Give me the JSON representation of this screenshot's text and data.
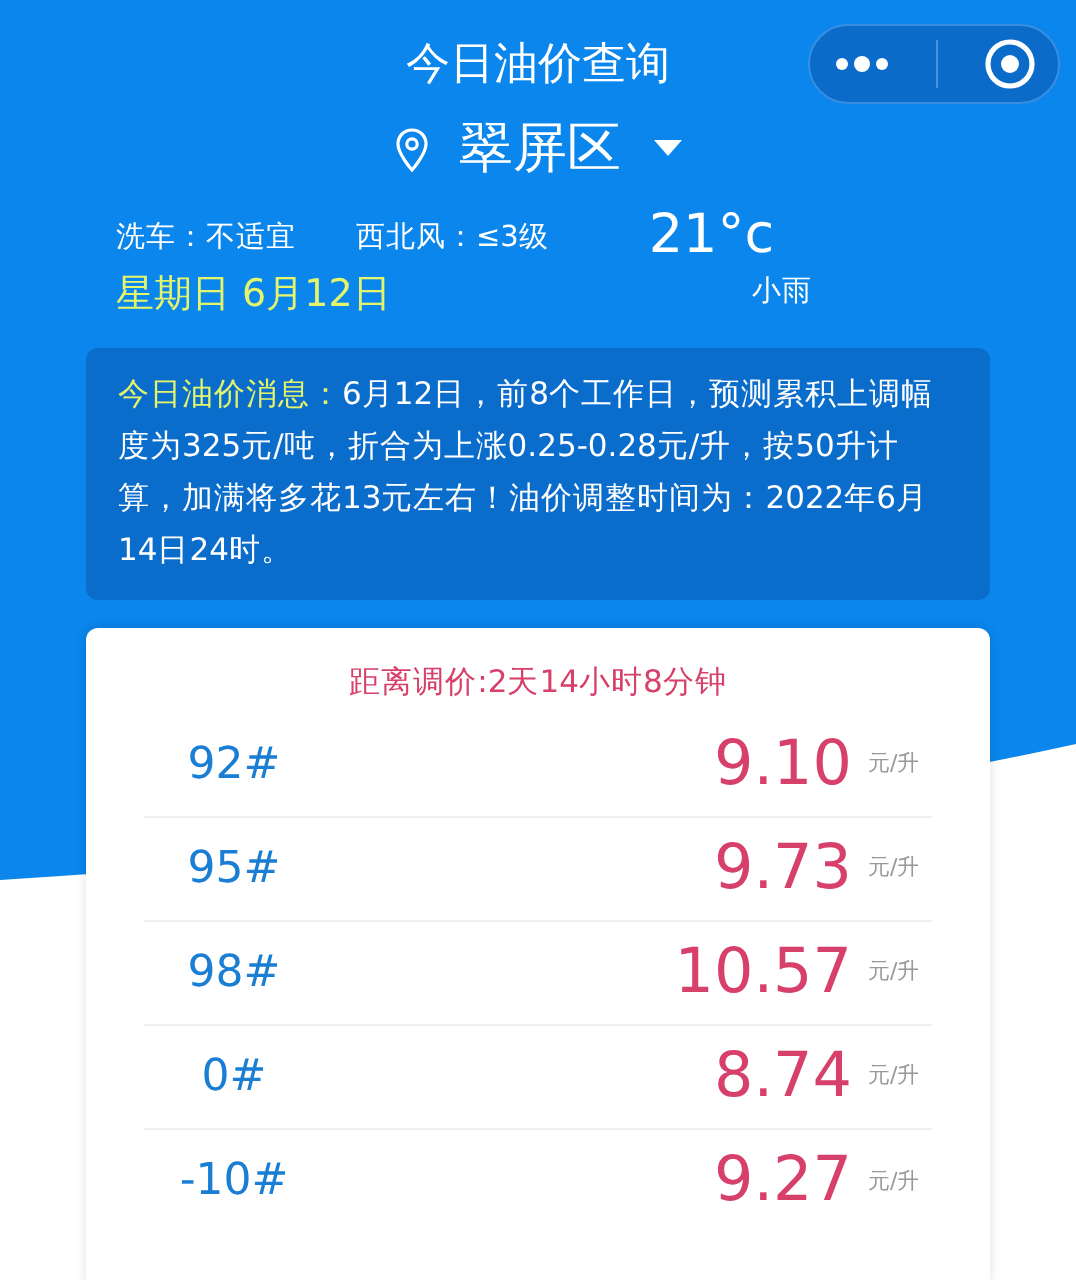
{
  "title": "今日油价查询",
  "location": {
    "name": "翠屏区"
  },
  "weather": {
    "car_wash": "洗车：不适宜",
    "wind": "西北风：≤3级",
    "temperature": "21°c",
    "condition": "小雨"
  },
  "date": "星期日 6月12日",
  "notice": {
    "label": "今日油价消息：",
    "text": "6月12日，前8个工作日，预测累积上调幅度为325元/吨，折合为上涨0.25-0.28元/升，按50升计算，加满将多花13元左右！油价调整时间为：2022年6月14日24时。"
  },
  "countdown": "距离调价:2天14小时8分钟",
  "prices": [
    {
      "grade": "92#",
      "price": "9.10",
      "unit": "元/升"
    },
    {
      "grade": "95#",
      "price": "9.73",
      "unit": "元/升"
    },
    {
      "grade": "98#",
      "price": "10.57",
      "unit": "元/升"
    },
    {
      "grade": "0#",
      "price": "8.74",
      "unit": "元/升"
    },
    {
      "grade": "-10#",
      "price": "9.27",
      "unit": "元/升"
    }
  ]
}
